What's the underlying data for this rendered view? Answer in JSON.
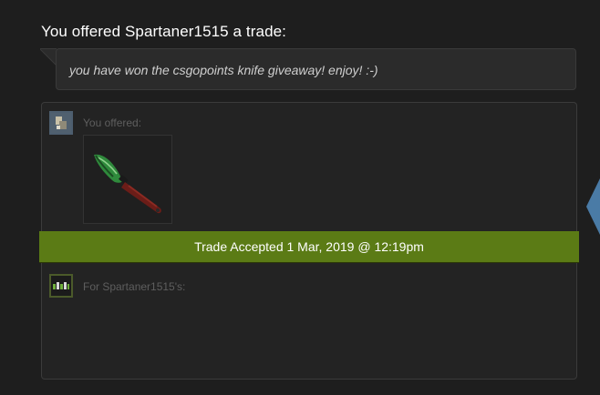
{
  "headline": "You offered Spartaner1515 a trade:",
  "message": "you have won the csgopoints knife giveaway! enjoy! :-)",
  "trade": {
    "you_offered_label": "You offered:",
    "for_label": "For Spartaner1515's:",
    "status_text": "Trade Accepted 1 Mar, 2019 @ 12:19pm",
    "status_color": "#5b7b15",
    "offered_items": [
      {
        "icon": "knife-item-icon",
        "rarity_color": "#2e7d32"
      }
    ]
  },
  "colors": {
    "background": "#1e1e1e",
    "box": "#232323",
    "quote_box": "#2b2b2b",
    "accent_blue": "#4a7ba6"
  }
}
